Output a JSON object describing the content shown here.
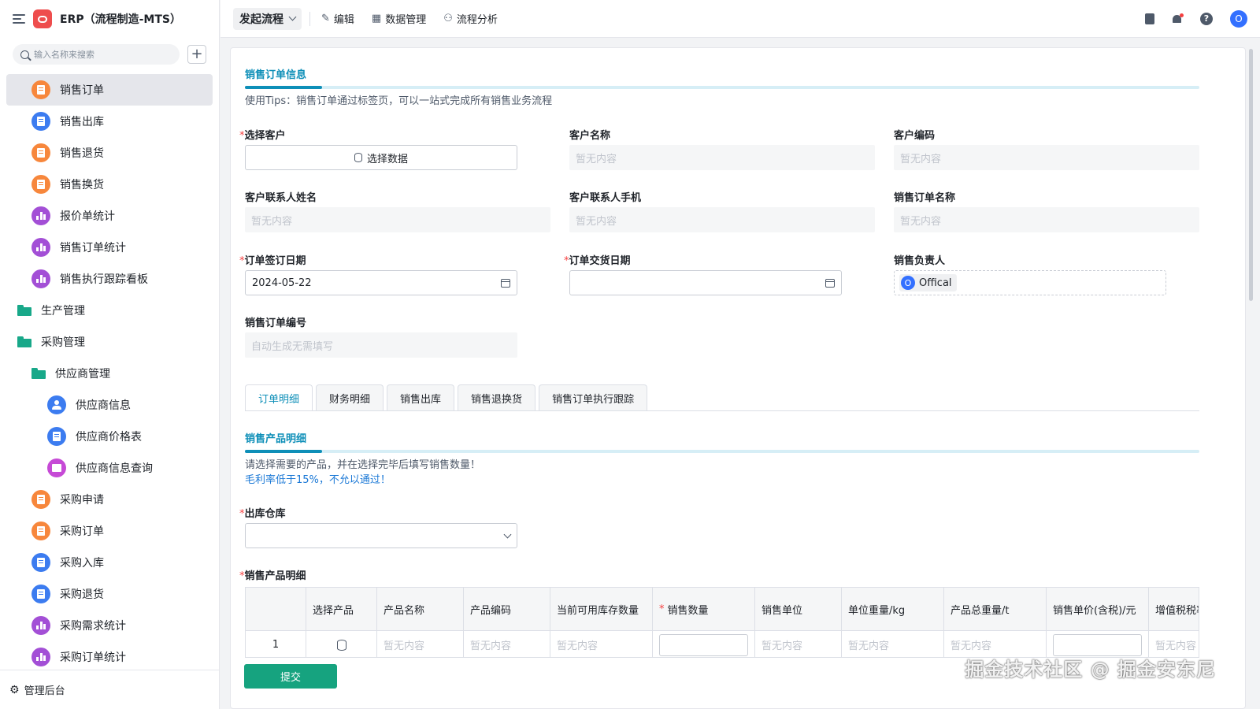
{
  "app": {
    "title": "ERP（流程制造-MTS）"
  },
  "sidebar": {
    "search_placeholder": "输入名称来搜索",
    "items": [
      {
        "label": "销售订单",
        "icon": "doc-icon",
        "color": "orange",
        "indent": 1,
        "active": true
      },
      {
        "label": "销售出库",
        "icon": "doc-icon",
        "color": "blue",
        "indent": 1
      },
      {
        "label": "销售退货",
        "icon": "doc-icon",
        "color": "orange",
        "indent": 1
      },
      {
        "label": "销售换货",
        "icon": "doc-icon",
        "color": "orange",
        "indent": 1
      },
      {
        "label": "报价单统计",
        "icon": "chart-icon",
        "color": "purple",
        "indent": 1
      },
      {
        "label": "销售订单统计",
        "icon": "chart-icon",
        "color": "purple",
        "indent": 1
      },
      {
        "label": "销售执行跟踪看板",
        "icon": "chart-icon",
        "color": "purple",
        "indent": 1
      },
      {
        "label": "生产管理",
        "icon": "folder-icon",
        "color": "green",
        "indent": 0
      },
      {
        "label": "采购管理",
        "icon": "folder-icon",
        "color": "green",
        "indent": 0
      },
      {
        "label": "供应商管理",
        "icon": "folder-icon",
        "color": "green",
        "indent": 1
      },
      {
        "label": "供应商信息",
        "icon": "person-icon",
        "color": "blue",
        "indent": 2
      },
      {
        "label": "供应商价格表",
        "icon": "doc-icon",
        "color": "blue",
        "indent": 2
      },
      {
        "label": "供应商信息查询",
        "icon": "report-icon",
        "color": "magenta",
        "indent": 2
      },
      {
        "label": "采购申请",
        "icon": "doc-icon",
        "color": "orange",
        "indent": 1
      },
      {
        "label": "采购订单",
        "icon": "doc-icon",
        "color": "orange",
        "indent": 1
      },
      {
        "label": "采购入库",
        "icon": "doc-icon",
        "color": "blue",
        "indent": 1
      },
      {
        "label": "采购退货",
        "icon": "doc-icon",
        "color": "blue",
        "indent": 1
      },
      {
        "label": "采购需求统计",
        "icon": "chart-icon",
        "color": "purple",
        "indent": 1
      },
      {
        "label": "采购订单统计",
        "icon": "chart-icon",
        "color": "purple",
        "indent": 1
      }
    ],
    "footer": "管理后台"
  },
  "topbar": {
    "launch": "发起流程",
    "edit": "编辑",
    "data": "数据管理",
    "analysis": "流程分析",
    "avatar": "O"
  },
  "form": {
    "section_title": "销售订单信息",
    "tip": "使用Tips：销售订单通过标签页，可以一站式完成所有销售业务流程",
    "empty": "暂无内容",
    "select_customer_label": "选择客户",
    "select_data_button": "选择数据",
    "customer_name_label": "客户名称",
    "customer_code_label": "客户编码",
    "contact_name_label": "客户联系人姓名",
    "contact_phone_label": "客户联系人手机",
    "order_name_label": "销售订单名称",
    "sign_date_label": "订单签订日期",
    "sign_date_value": "2024-05-22",
    "delivery_date_label": "订单交货日期",
    "sales_owner_label": "销售负责人",
    "sales_owner_value": "Offical",
    "sales_owner_avatar": "O",
    "order_no_label": "销售订单编号",
    "order_no_placeholder": "自动生成无需填写"
  },
  "tabs": [
    "订单明细",
    "财务明细",
    "销售出库",
    "销售退换货",
    "销售订单执行跟踪"
  ],
  "detail": {
    "section_title": "销售产品明细",
    "tip1": "请选择需要的产品，并在选择完毕后填写销售数量！",
    "tip2": "毛利率低于15%，不允以通过！",
    "warehouse_label": "出库仓库",
    "table_label": "销售产品明细",
    "columns": [
      "",
      "选择产品",
      "产品名称",
      "产品编码",
      "当前可用库存数量",
      "销售数量",
      "销售单位",
      "单位重量/kg",
      "产品总重量/t",
      "销售单价(含税)/元",
      "增值税税率"
    ],
    "row": {
      "index": "1",
      "empty": "暂无内容"
    }
  },
  "submit": "提交",
  "watermark": "掘金技术社区 @ 掘金安东尼"
}
